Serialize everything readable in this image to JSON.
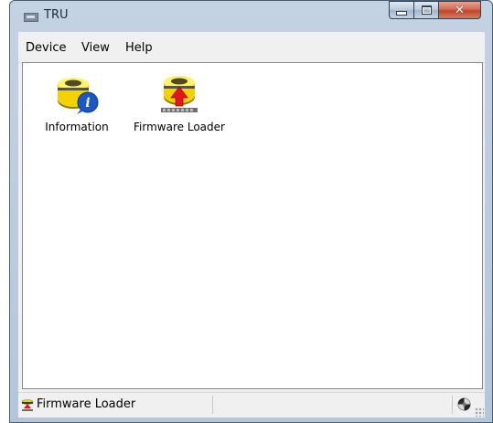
{
  "window": {
    "title": "TRU",
    "icon": "app-window-icon"
  },
  "caption_buttons": {
    "minimize": "minimize-icon",
    "maximize": "maximize-icon",
    "close": "close-icon"
  },
  "menu": {
    "items": [
      {
        "label": "Device"
      },
      {
        "label": "View"
      },
      {
        "label": "Help"
      }
    ]
  },
  "content": {
    "items": [
      {
        "label": "Information",
        "icon": "gps-receiver-info-icon"
      },
      {
        "label": "Firmware Loader",
        "icon": "gps-receiver-firmware-icon"
      }
    ]
  },
  "statusbar": {
    "text": "Firmware Loader",
    "left_icon": "gps-receiver-small-icon",
    "right_icon": "connection-status-icon"
  },
  "colors": {
    "receiver_yellow": "#f2d200",
    "info_blue": "#1a56c4",
    "arrow_red": "#e3161b",
    "titlebar": "#bfd0e2"
  }
}
